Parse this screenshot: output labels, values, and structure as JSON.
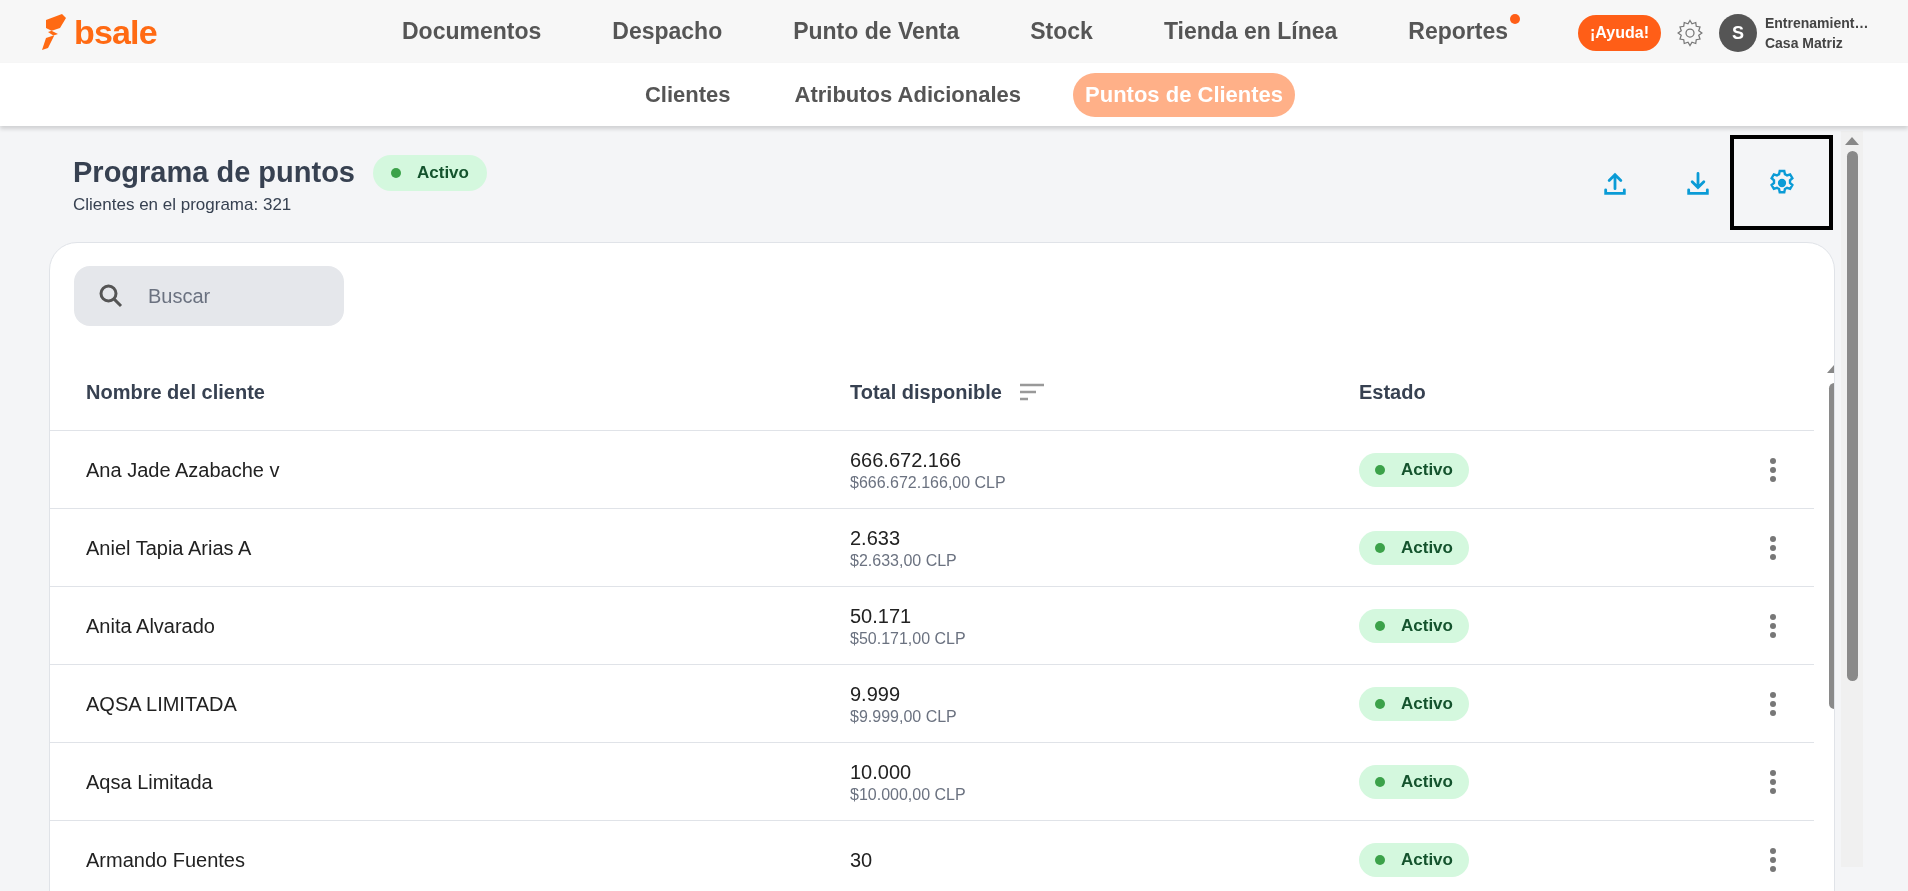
{
  "brand": {
    "name": "bsale"
  },
  "main_nav": [
    {
      "label": "Documentos",
      "notification": false
    },
    {
      "label": "Despacho",
      "notification": false
    },
    {
      "label": "Punto de Venta",
      "notification": false
    },
    {
      "label": "Stock",
      "notification": false
    },
    {
      "label": "Tienda en Línea",
      "notification": false
    },
    {
      "label": "Reportes",
      "notification": true
    }
  ],
  "help_button": "¡Ayuda!",
  "user": {
    "initial": "S",
    "name": "Entrenamient…",
    "branch": "Casa Matriz"
  },
  "sub_nav": [
    {
      "label": "Clientes",
      "selected": false
    },
    {
      "label": "Atributos Adicionales",
      "selected": false
    },
    {
      "label": "Puntos de Clientes",
      "selected": true
    }
  ],
  "program": {
    "title": "Programa de puntos",
    "status": "Activo",
    "active": true,
    "subtitle": "Clientes en el programa: 321"
  },
  "search": {
    "placeholder": "Buscar"
  },
  "table": {
    "columns": [
      "Nombre del cliente",
      "Total disponible",
      "Estado"
    ],
    "rows": [
      {
        "name": "Ana Jade Azabache v",
        "total": "666.672.166",
        "amount": "$666.672.166,00 CLP",
        "status": "Activo",
        "active": true
      },
      {
        "name": "Aniel Tapia Arias A",
        "total": "2.633",
        "amount": "$2.633,00 CLP",
        "status": "Activo",
        "active": true
      },
      {
        "name": "Anita Alvarado",
        "total": "50.171",
        "amount": "$50.171,00 CLP",
        "status": "Activo",
        "active": true
      },
      {
        "name": "AQSA LIMITADA",
        "total": "9.999",
        "amount": "$9.999,00 CLP",
        "status": "Activo",
        "active": true
      },
      {
        "name": "Aqsa Limitada",
        "total": "10.000",
        "amount": "$10.000,00 CLP",
        "status": "Activo",
        "active": true
      },
      {
        "name": "Armando Fuentes",
        "total": "30",
        "status": "Activo",
        "active": true
      }
    ]
  }
}
